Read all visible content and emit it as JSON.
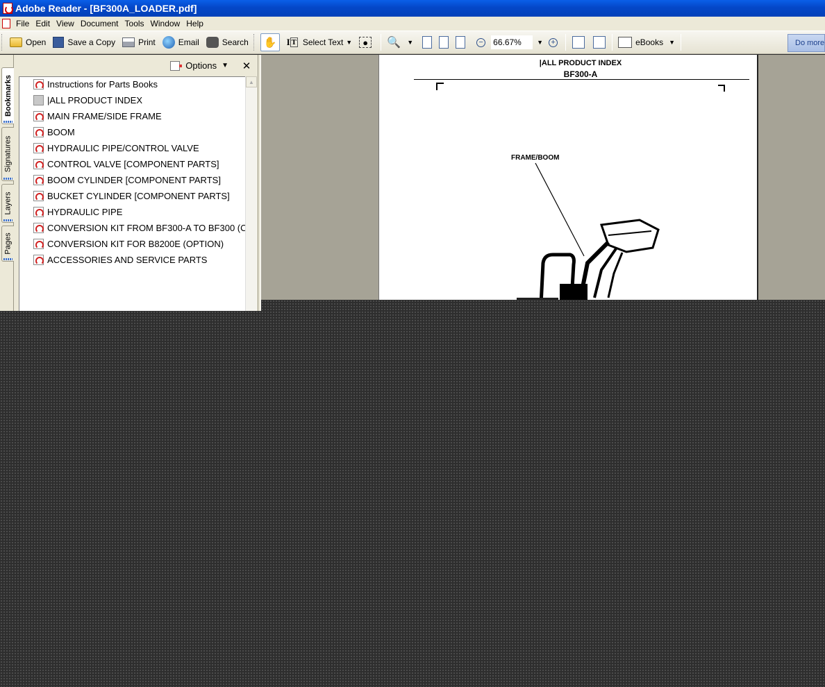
{
  "window": {
    "title": "Adobe Reader - [BF300A_LOADER.pdf]"
  },
  "menu": [
    "File",
    "Edit",
    "View",
    "Document",
    "Tools",
    "Window",
    "Help"
  ],
  "toolbar": {
    "open": "Open",
    "save_copy": "Save a Copy",
    "print": "Print",
    "email": "Email",
    "search": "Search",
    "select_text": "Select Text",
    "zoom": "66.67%",
    "ebooks": "eBooks",
    "do_more": "Do more"
  },
  "side_tabs": [
    "Bookmarks",
    "Signatures",
    "Layers",
    "Pages"
  ],
  "panel": {
    "options": "Options",
    "bookmarks": [
      "Instructions for Parts Books",
      "|ALL PRODUCT INDEX",
      "MAIN FRAME/SIDE FRAME",
      "BOOM",
      "HYDRAULIC PIPE/CONTROL VALVE",
      "CONTROL VALVE [COMPONENT PARTS]",
      "BOOM CYLINDER [COMPONENT PARTS]",
      "BUCKET CYLINDER [COMPONENT PARTS]",
      "HYDRAULIC PIPE",
      "CONVERSION KIT FROM BF300-A TO BF300 (C",
      "CONVERSION KIT FOR B8200E (OPTION)",
      "ACCESSORIES AND SERVICE PARTS"
    ]
  },
  "document": {
    "header": "|ALL PRODUCT INDEX",
    "model": "BF300-A",
    "callout": "FRAME/BOOM"
  }
}
